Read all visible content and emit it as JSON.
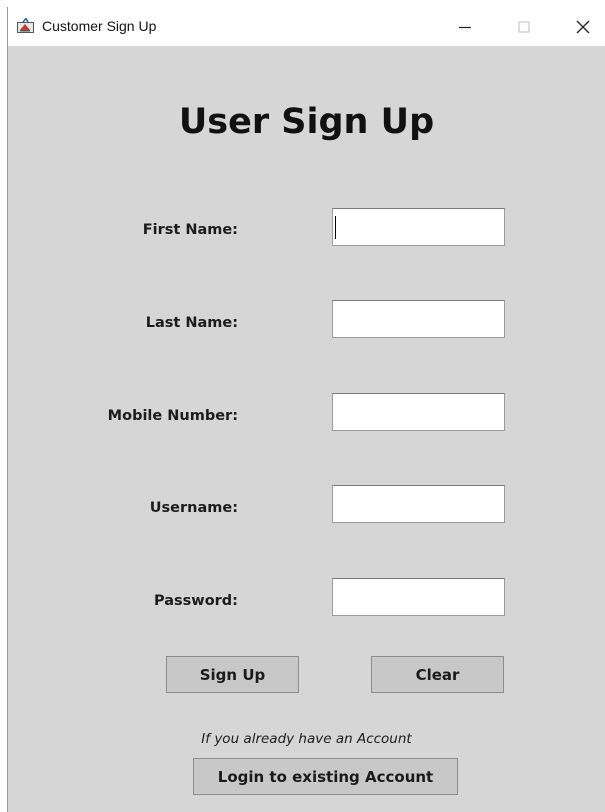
{
  "window": {
    "title": "Customer Sign Up",
    "icons": {
      "app": "java-cup-icon",
      "minimize": "minimize-icon",
      "maximize": "maximize-icon",
      "close": "close-icon"
    }
  },
  "form": {
    "heading": "User Sign Up",
    "fields": [
      {
        "label": "First Name:",
        "value": ""
      },
      {
        "label": "Last Name:",
        "value": ""
      },
      {
        "label": "Mobile Number:",
        "value": ""
      },
      {
        "label": "Username:",
        "value": ""
      },
      {
        "label": "Password:",
        "value": ""
      }
    ]
  },
  "buttons": {
    "signup": "Sign Up",
    "clear": "Clear",
    "login": "Login to existing Account"
  },
  "login_prompt": "If you already have an Account"
}
